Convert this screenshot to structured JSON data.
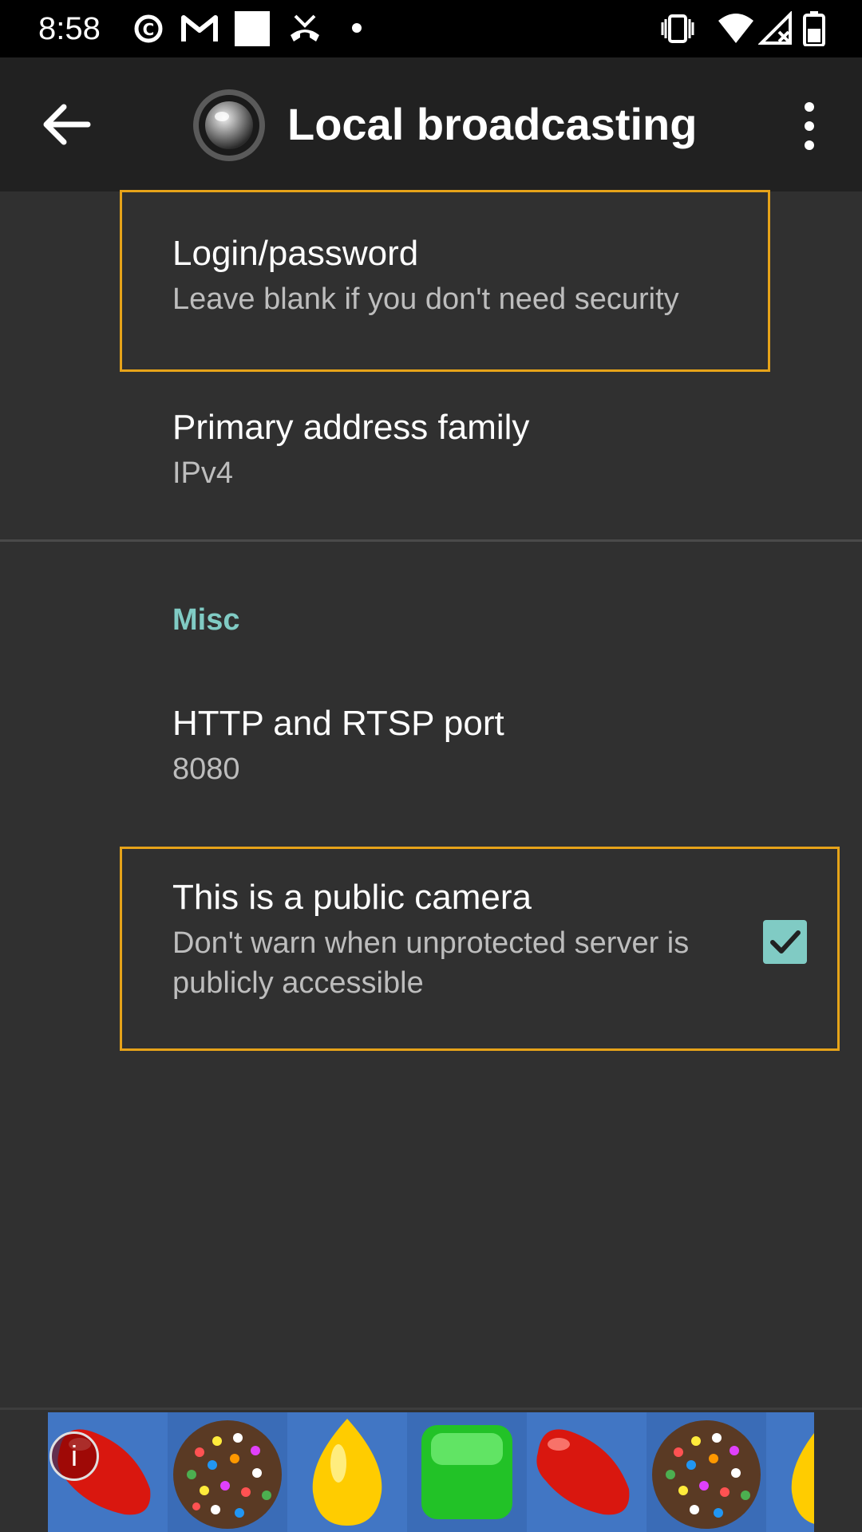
{
  "status_bar": {
    "time": "8:58",
    "icons_left": [
      "c-circle-icon",
      "gmail-icon",
      "white-square-icon",
      "missed-call-icon",
      "dot-icon"
    ],
    "icons_right": [
      "vibrate-icon",
      "wifi-icon",
      "signal-icon",
      "battery-icon"
    ]
  },
  "app_bar": {
    "title": "Local broadcasting",
    "back_icon": "arrow-left-icon",
    "logo_icon": "camera-lens-icon",
    "menu_icon": "more-vert-icon"
  },
  "preferences": {
    "login": {
      "title": "Login/password",
      "summary": "Leave blank if you don't need security"
    },
    "address_family": {
      "title": "Primary address family",
      "summary": "IPv4"
    },
    "misc_category": "Misc",
    "port": {
      "title": "HTTP and RTSP port",
      "summary": "8080"
    },
    "public_camera": {
      "title": "This is a public camera",
      "summary": "Don't warn when unprotected server is publicly accessible",
      "checked": true
    }
  },
  "ad": {
    "info_label": "i",
    "tiles": [
      "red-jellybean-icon",
      "chocolate-sprinkle-ball-icon",
      "yellow-lozenge-icon",
      "green-square-candy-icon",
      "red-jellybean-icon",
      "chocolate-sprinkle-ball-icon",
      "yellow-lozenge-icon"
    ]
  },
  "colors": {
    "accent": "#80cbc4",
    "focus": "#e6a319",
    "background": "#303030",
    "app_bar": "#212121"
  }
}
